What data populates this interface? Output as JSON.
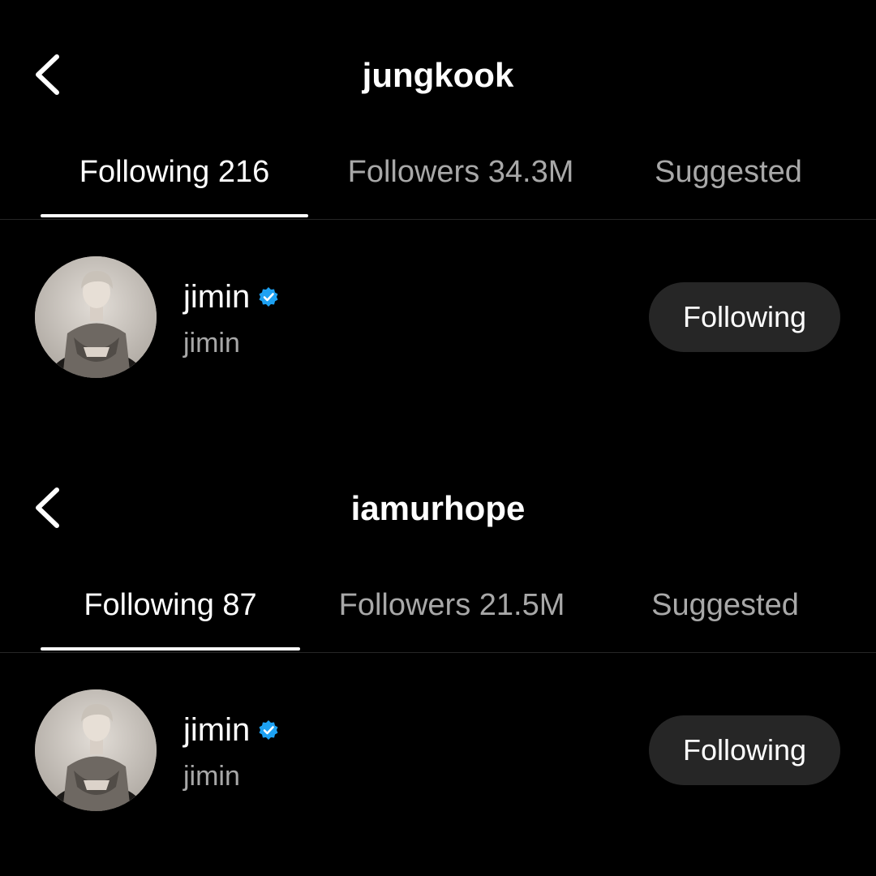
{
  "colors": {
    "background": "#000000",
    "text_primary": "#ffffff",
    "text_secondary": "#a8a8a8",
    "button_bg": "#262626",
    "verified": "#1da1f2"
  },
  "panels": [
    {
      "header": {
        "title": "jungkook",
        "back_icon": "chevron-left-icon"
      },
      "tabs": [
        {
          "label": "Following 216",
          "active": true
        },
        {
          "label": "Followers 34.3M",
          "active": false
        },
        {
          "label": "Suggested",
          "active": false
        }
      ],
      "rows": [
        {
          "username": "jimin",
          "subtitle": "jimin",
          "verified_icon": "verified-badge-icon",
          "button_label": "Following"
        }
      ]
    },
    {
      "header": {
        "title": "iamurhope",
        "back_icon": "chevron-left-icon"
      },
      "tabs": [
        {
          "label": "Following 87",
          "active": true
        },
        {
          "label": "Followers 21.5M",
          "active": false
        },
        {
          "label": "Suggested",
          "active": false
        }
      ],
      "rows": [
        {
          "username": "jimin",
          "subtitle": "jimin",
          "verified_icon": "verified-badge-icon",
          "button_label": "Following"
        }
      ]
    }
  ]
}
